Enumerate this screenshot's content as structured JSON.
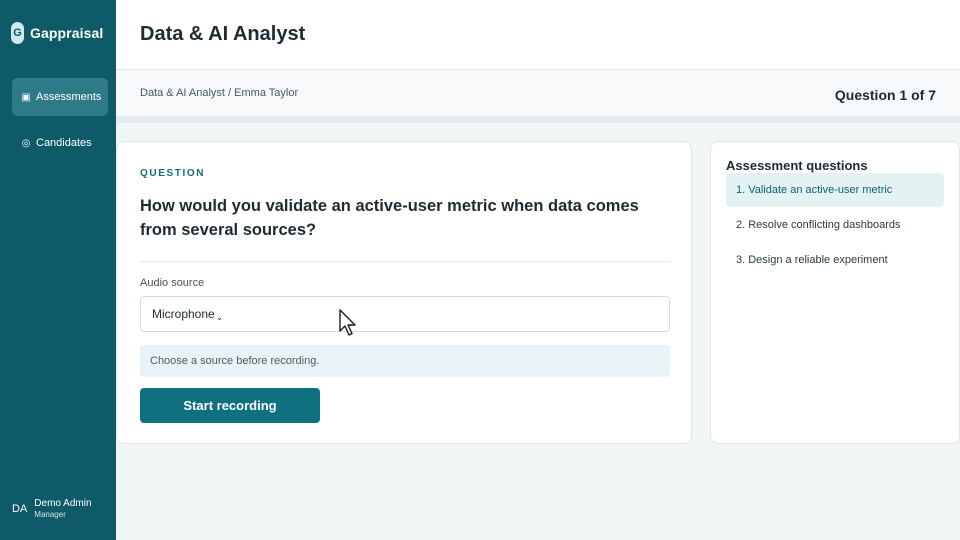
{
  "brand": {
    "logo_letter": "G",
    "name": "Gappraisal"
  },
  "sidebar": {
    "items": [
      {
        "label": "Assessments",
        "icon": "list-icon",
        "glyph": "▣",
        "active": true
      },
      {
        "label": "Candidates",
        "icon": "candidates-icon",
        "glyph": "◎",
        "active": false
      }
    ],
    "user": {
      "initials": "DA",
      "name": "Demo Admin",
      "role": "Manager"
    }
  },
  "header": {
    "title": "Data & AI Analyst"
  },
  "subbar": {
    "breadcrumb": "Data & AI Analyst / Emma Taylor",
    "question_count": "Question 1 of 7"
  },
  "question": {
    "label": "QUESTION",
    "text": "How would you validate an active-user metric when data comes from several sources?"
  },
  "audio": {
    "label": "Audio source",
    "selected": "Microphone",
    "chevron": "⌄",
    "hint": "Choose a source before recording.",
    "record_label": "Start recording"
  },
  "panel": {
    "title": "Assessment questions",
    "items": [
      {
        "label": "1. Validate an active-user metric",
        "active": true
      },
      {
        "label": "2. Resolve conflicting dashboards",
        "active": false
      },
      {
        "label": "3. Design a reliable experiment",
        "active": false
      }
    ]
  },
  "colors": {
    "sidebar": "#0e5a69",
    "accent": "#0f7080",
    "active_item": "#e5f2f4"
  }
}
